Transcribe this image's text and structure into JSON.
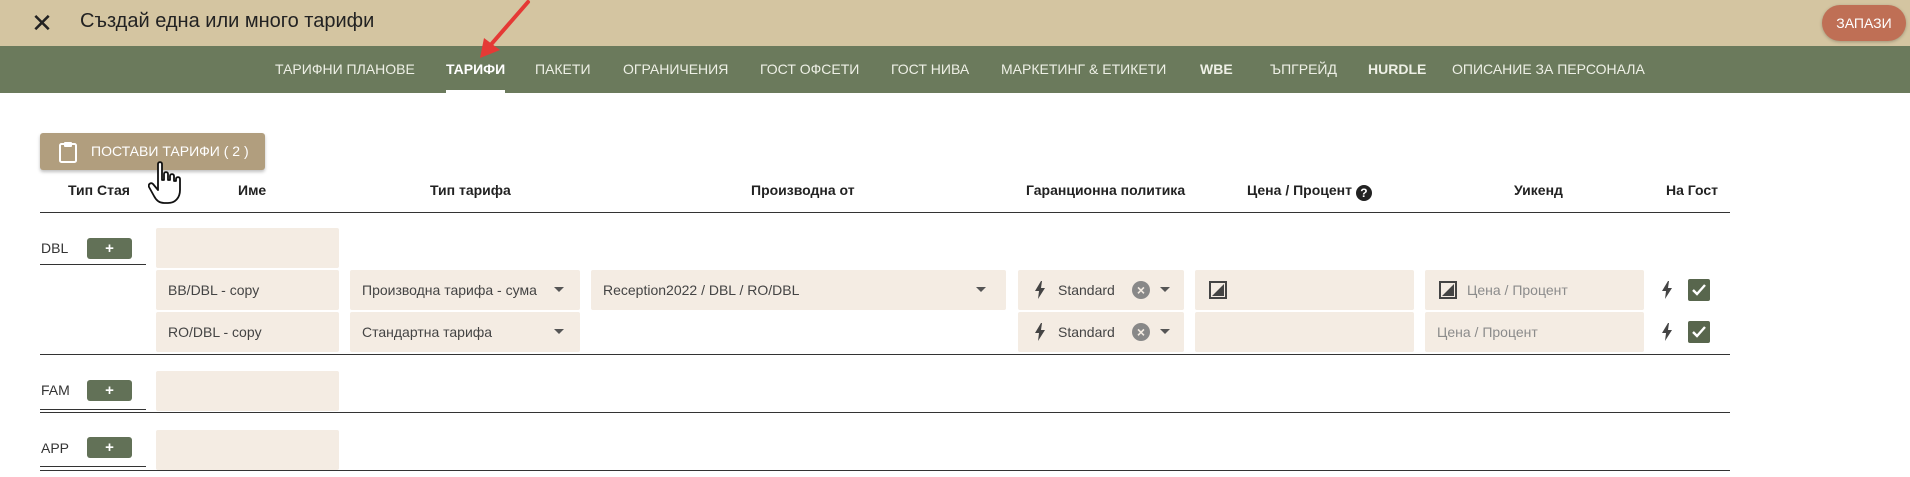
{
  "header": {
    "title": "Създай една или много тарифи",
    "save_label": "ЗАПАЗИ",
    "close_icon": "close-icon",
    "colors": {
      "topbar": "#d4c5a1",
      "save": "#bf6f55"
    }
  },
  "nav": {
    "tabs": [
      {
        "label": "ТАРИФНИ ПЛАНОВЕ"
      },
      {
        "label": "ТАРИФИ"
      },
      {
        "label": "ПАКЕТИ"
      },
      {
        "label": "ОГРАНИЧЕНИЯ"
      },
      {
        "label": "ГОСТ ОФСЕТИ"
      },
      {
        "label": "ГОСТ НИВА"
      },
      {
        "label": "МАРКЕТИНГ & ЕТИКЕТИ"
      },
      {
        "label": "WBE"
      },
      {
        "label": "ЪПГРЕЙД"
      },
      {
        "label": "HURDLE"
      },
      {
        "label": "ОПИСАНИЕ ЗА ПЕРСОНАЛА"
      }
    ],
    "active": "ТАРИФИ",
    "color": "#6b7a5c"
  },
  "toolbar": {
    "paste_label": "ПОСТАВИ ТАРИФИ ( 2 )"
  },
  "table": {
    "headers": {
      "room_type": "Тип Стая",
      "name": "Име",
      "rate_type": "Тип тарифа",
      "derived_from": "Производна от",
      "guarantee": "Гаранционна политика",
      "price": "Цена / Процент",
      "weekend": "Уикенд",
      "guest": "На Гост"
    },
    "groups": [
      {
        "room": "DBL",
        "add_label": "+",
        "rows": [
          {
            "name": "BB/DBL - copy",
            "rate_type": "Производна тарифа - сума",
            "derived_from": "Reception2022 / DBL / RO/DBL",
            "guarantee": "Standard",
            "price": "",
            "weekend_placeholder": "Цена / Процент",
            "guest_checked": true
          },
          {
            "name": "RO/DBL - copy",
            "rate_type": "Стандартна тарифа",
            "derived_from": "",
            "guarantee": "Standard",
            "price": "",
            "weekend_placeholder": "Цена / Процент",
            "guest_checked": true
          }
        ]
      },
      {
        "room": "FAM",
        "add_label": "+",
        "rows": []
      },
      {
        "room": "APP",
        "add_label": "+",
        "rows": []
      }
    ]
  }
}
